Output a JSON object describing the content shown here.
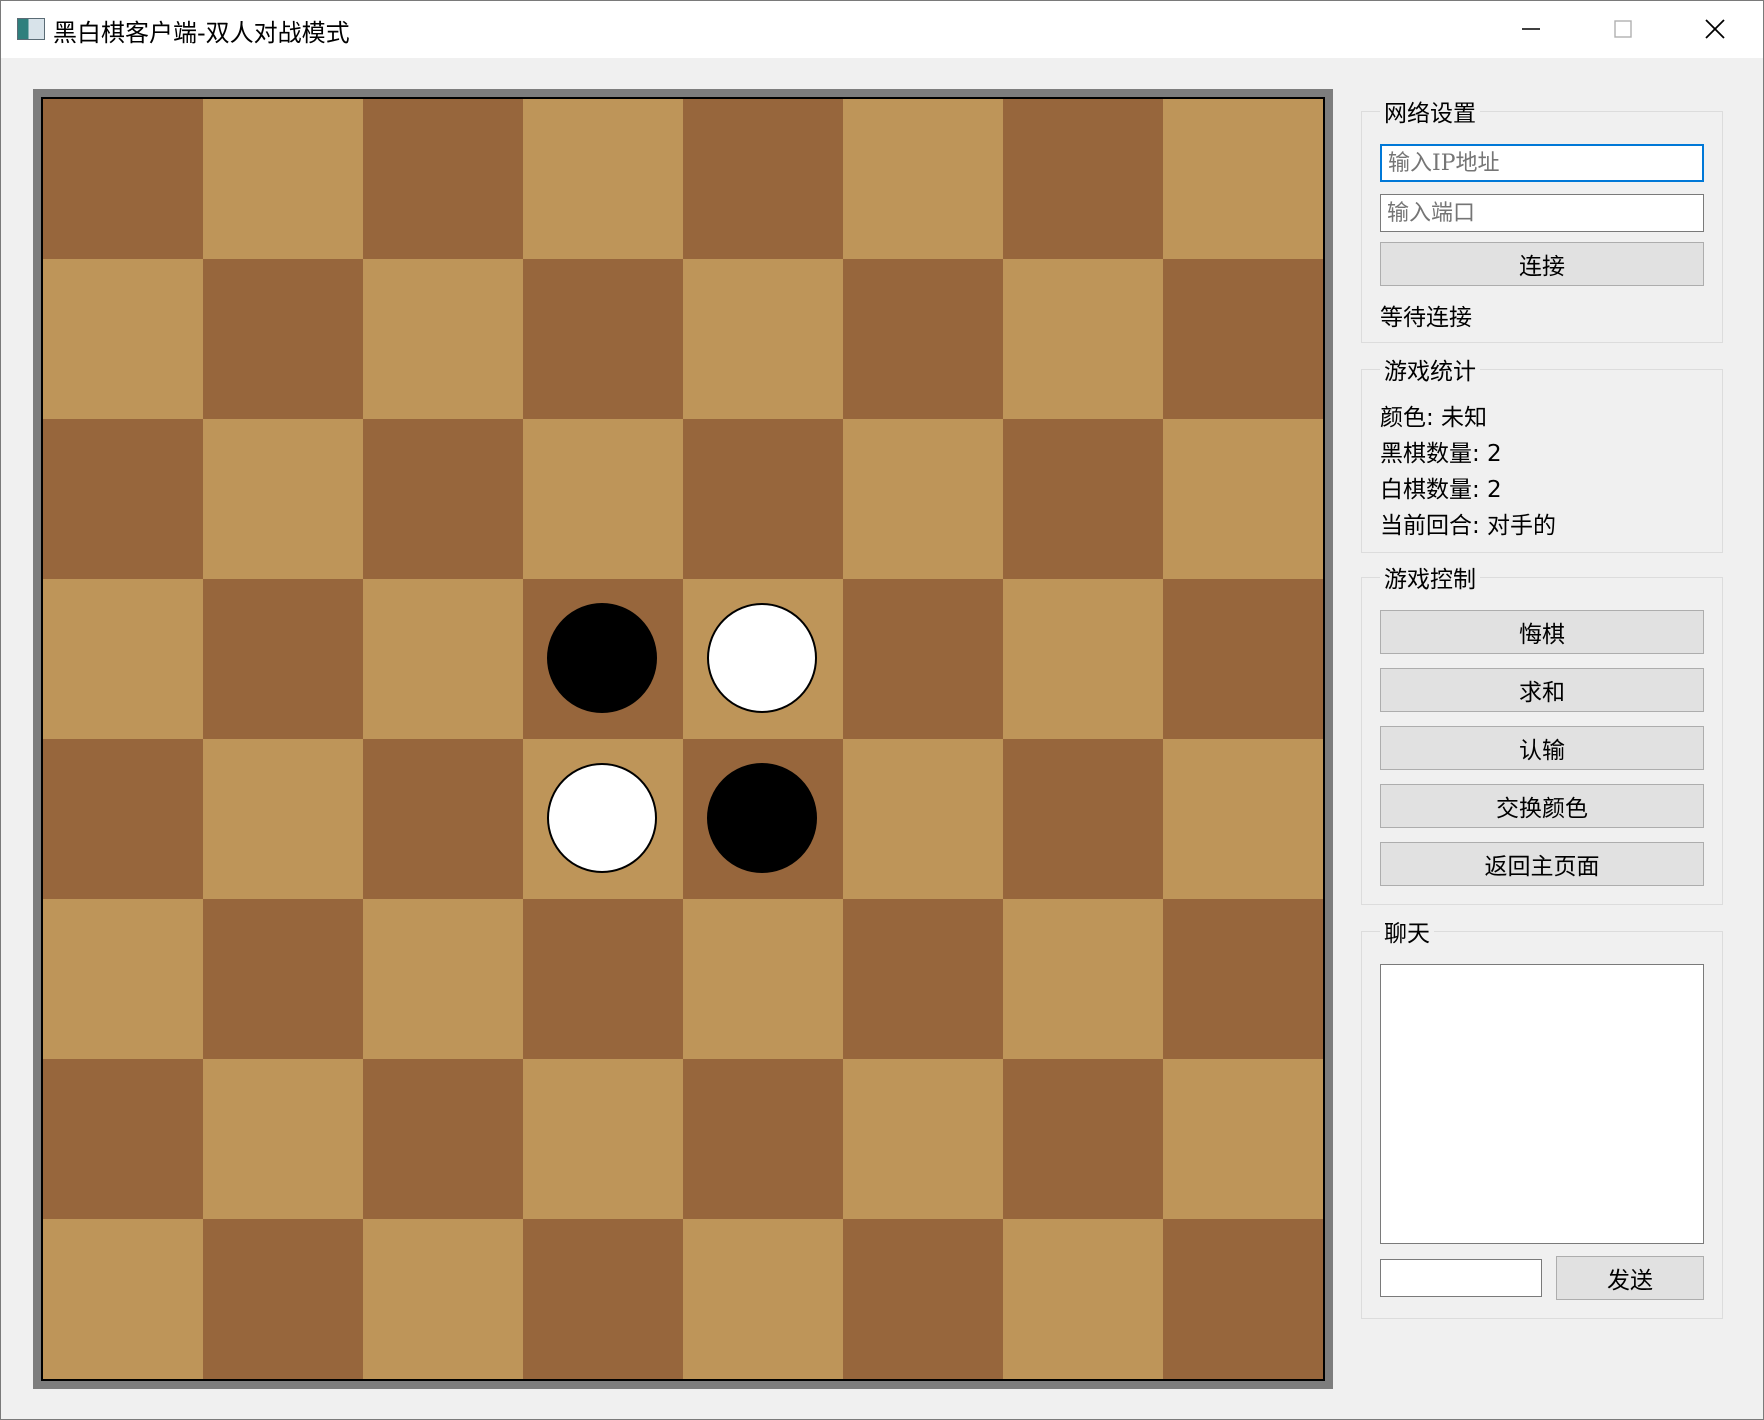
{
  "window": {
    "title": "黑白棋客户端-双人对战模式"
  },
  "board": {
    "size": 8,
    "colors": {
      "dark": "#97663c",
      "light": "#be9559",
      "black": "#000000",
      "white": "#ffffff"
    },
    "pieces": [
      {
        "row": 3,
        "col": 3,
        "color": "black"
      },
      {
        "row": 3,
        "col": 4,
        "color": "white"
      },
      {
        "row": 4,
        "col": 3,
        "color": "white"
      },
      {
        "row": 4,
        "col": 4,
        "color": "black"
      }
    ]
  },
  "network": {
    "title": "网络设置",
    "ip_placeholder": "输入IP地址",
    "port_placeholder": "输入端口",
    "connect_label": "连接",
    "status": "等待连接"
  },
  "stats": {
    "title": "游戏统计",
    "color": "颜色: 未知",
    "black_count": "黑棋数量: 2",
    "white_count": "白棋数量: 2",
    "current_turn": "当前回合: 对手的"
  },
  "controls": {
    "title": "游戏控制",
    "undo": "悔棋",
    "draw": "求和",
    "resign": "认输",
    "swap_color": "交换颜色",
    "back_home": "返回主页面"
  },
  "chat": {
    "title": "聊天",
    "send": "发送"
  }
}
